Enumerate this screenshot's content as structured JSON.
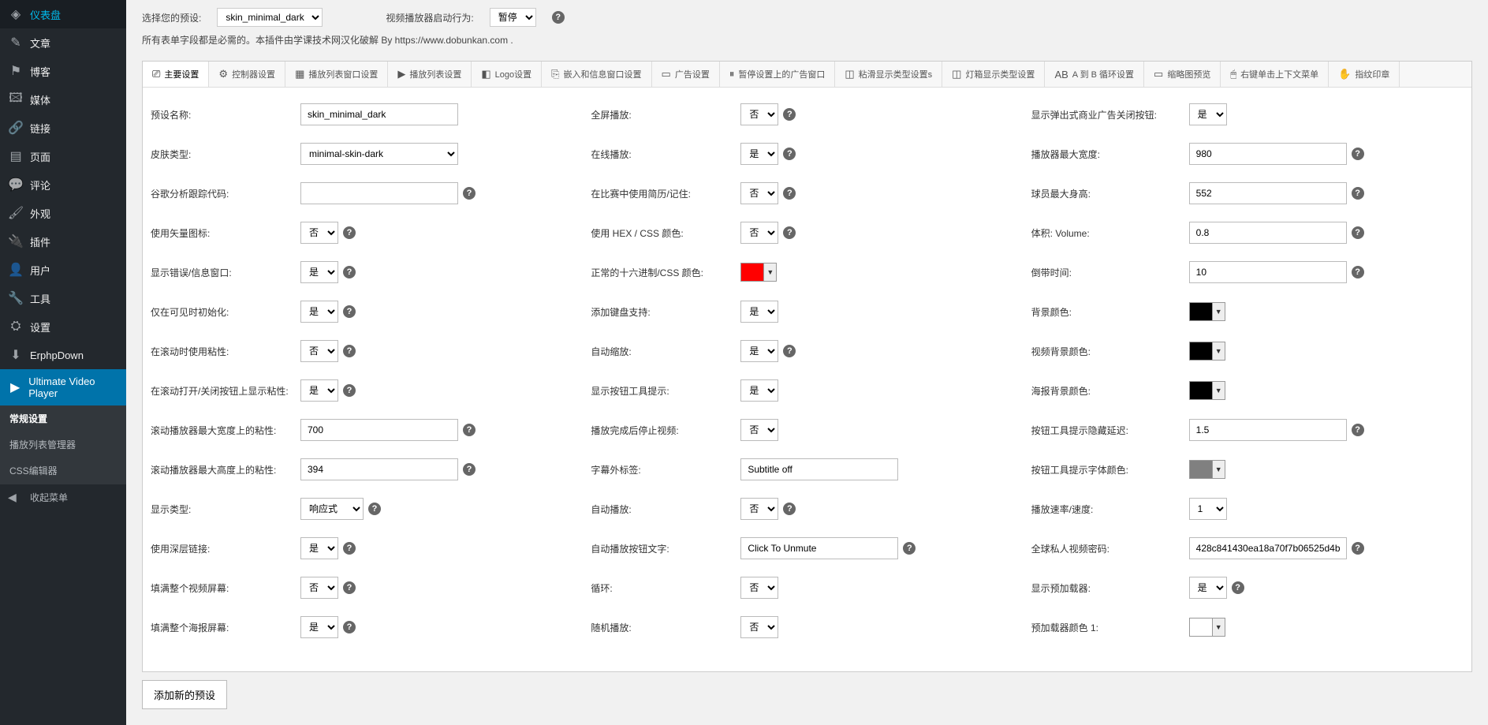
{
  "sidebar": {
    "items": [
      {
        "icon": "◈",
        "label": "仪表盘"
      },
      {
        "icon": "✎",
        "label": "文章"
      },
      {
        "icon": "⚑",
        "label": "博客"
      },
      {
        "icon": "🖾",
        "label": "媒体"
      },
      {
        "icon": "🔗",
        "label": "链接"
      },
      {
        "icon": "▤",
        "label": "页面"
      },
      {
        "icon": "💬",
        "label": "评论"
      },
      {
        "icon": "🖌",
        "label": "外观"
      },
      {
        "icon": "🔌",
        "label": "插件"
      },
      {
        "icon": "👤",
        "label": "用户"
      },
      {
        "icon": "🔧",
        "label": "工具"
      },
      {
        "icon": "⛭",
        "label": "设置"
      },
      {
        "icon": "⬇",
        "label": "ErphpDown"
      },
      {
        "icon": "▶",
        "label": "Ultimate Video Player",
        "active": true
      }
    ],
    "sub": [
      "常规设置",
      "播放列表管理器",
      "CSS编辑器"
    ],
    "sub_current": "常规设置",
    "collapse": "收起菜单"
  },
  "top": {
    "preset_label": "选择您的预设:",
    "preset_value": "skin_minimal_dark",
    "startup_label": "视频播放器启动行为:",
    "startup_value": "暂停"
  },
  "note": "所有表单字段都是必需的。本插件由学课技术网汉化破解 By https://www.dobunkan.com .",
  "tabs": [
    {
      "icon": "⎚",
      "label": "主要设置",
      "active": true
    },
    {
      "icon": "⚙",
      "label": "控制器设置"
    },
    {
      "icon": "▦",
      "label": "播放列表窗口设置"
    },
    {
      "icon": "▶",
      "label": "播放列表设置"
    },
    {
      "icon": "◧",
      "label": "Logo设置"
    },
    {
      "icon": "⎘",
      "label": "嵌入和信息窗口设置"
    },
    {
      "icon": "▭",
      "label": "广告设置"
    },
    {
      "icon": "⏸",
      "label": "暂停设置上的广告窗口"
    },
    {
      "icon": "◫",
      "label": "粘滑显示类型设置s"
    },
    {
      "icon": "◫",
      "label": "灯箱显示类型设置"
    },
    {
      "icon": "AB",
      "label": "A 到 B 循环设置"
    },
    {
      "icon": "▭",
      "label": "缩略图预览"
    },
    {
      "icon": "🖱",
      "label": "右键单击上下文菜单"
    },
    {
      "icon": "✋",
      "label": "指纹印章"
    }
  ],
  "f": {
    "c1": [
      {
        "label": "预设名称:",
        "type": "text",
        "value": "skin_minimal_dark",
        "help": 0
      },
      {
        "label": "皮肤类型:",
        "type": "select_med",
        "value": "minimal-skin-dark",
        "help": 0
      },
      {
        "label": "谷歌分析跟踪代码:",
        "type": "text",
        "value": "",
        "help": 1
      },
      {
        "label": "使用矢量图标:",
        "type": "select_small",
        "value": "否",
        "help": 1
      },
      {
        "label": "显示错误/信息窗口:",
        "type": "select_small",
        "value": "是",
        "help": 1
      },
      {
        "label": "仅在可见时初始化:",
        "type": "select_small",
        "value": "是",
        "help": 1
      },
      {
        "label": "在滚动时使用粘性:",
        "type": "select_small",
        "value": "否",
        "help": 1
      },
      {
        "label": "在滚动打开/关闭按钮上显示粘性:",
        "type": "select_small",
        "value": "是",
        "help": 1
      },
      {
        "label": "滚动播放器最大宽度上的粘性:",
        "type": "text",
        "value": "700",
        "help": 1
      },
      {
        "label": "滚动播放器最大高度上的粘性:",
        "type": "text",
        "value": "394",
        "help": 1
      },
      {
        "label": "显示类型:",
        "type": "select_med_v",
        "value": "响应式",
        "help": 1
      },
      {
        "label": "使用深层链接:",
        "type": "select_small",
        "value": "是",
        "help": 1
      },
      {
        "label": "填满整个视频屏幕:",
        "type": "select_small",
        "value": "否",
        "help": 1
      },
      {
        "label": "填满整个海报屏幕:",
        "type": "select_small",
        "value": "是",
        "help": 1
      }
    ],
    "c2": [
      {
        "label": "全屏播放:",
        "type": "select_small",
        "value": "否",
        "help": 1
      },
      {
        "label": "在线播放:",
        "type": "select_small",
        "value": "是",
        "help": 1
      },
      {
        "label": "在比赛中使用简历/记住:",
        "type": "select_small",
        "value": "否",
        "help": 1
      },
      {
        "label": "使用 HEX / CSS 颜色:",
        "type": "select_small",
        "value": "否",
        "help": 1
      },
      {
        "label": "正常的十六进制/CSS 颜色:",
        "type": "color",
        "value": "#FF0000",
        "help": 0
      },
      {
        "label": "添加键盘支持:",
        "type": "select_small",
        "value": "是",
        "help": 0
      },
      {
        "label": "自动缩放:",
        "type": "select_small",
        "value": "是",
        "help": 1
      },
      {
        "label": "显示按钮工具提示:",
        "type": "select_small",
        "value": "是",
        "help": 0
      },
      {
        "label": "播放完成后停止视频:",
        "type": "select_small",
        "value": "否",
        "help": 0
      },
      {
        "label": "字幕外标签:",
        "type": "text",
        "value": "Subtitle off",
        "help": 0
      },
      {
        "label": "自动播放:",
        "type": "select_small",
        "value": "否",
        "help": 1
      },
      {
        "label": "自动播放按钮文字:",
        "type": "text",
        "value": "Click To Unmute",
        "help": 1
      },
      {
        "label": "循环:",
        "type": "select_small",
        "value": "否",
        "help": 0
      },
      {
        "label": "随机播放:",
        "type": "select_small",
        "value": "否",
        "help": 0
      }
    ],
    "c3": [
      {
        "label": "显示弹出式商业广告关闭按钮:",
        "type": "select_small",
        "value": "是",
        "help": 0
      },
      {
        "label": "播放器最大宽度:",
        "type": "text",
        "value": "980",
        "help": 1
      },
      {
        "label": "球员最大身高:",
        "type": "text",
        "value": "552",
        "help": 1
      },
      {
        "label": "体积: Volume:",
        "type": "text",
        "value": "0.8",
        "help": 1
      },
      {
        "label": "倒带时间:",
        "type": "text",
        "value": "10",
        "help": 1
      },
      {
        "label": "背景颜色:",
        "type": "color",
        "value": "#000000",
        "help": 0
      },
      {
        "label": "视频背景颜色:",
        "type": "color",
        "value": "#000000",
        "help": 0
      },
      {
        "label": "海报背景颜色:",
        "type": "color",
        "value": "#000000",
        "help": 0
      },
      {
        "label": "按钮工具提示隐藏延迟:",
        "type": "text",
        "value": "1.5",
        "help": 1
      },
      {
        "label": "按钮工具提示字体颜色:",
        "type": "color",
        "value": "#808080",
        "help": 0
      },
      {
        "label": "播放速率/速度:",
        "type": "select_small",
        "value": "1",
        "help": 0
      },
      {
        "label": "全球私人视频密码:",
        "type": "text",
        "value": "428c841430ea18a70f7b06525d4b",
        "help": 1
      },
      {
        "label": "显示预加载器:",
        "type": "select_small",
        "value": "是",
        "help": 1
      },
      {
        "label": "预加载器颜色 1:",
        "type": "color",
        "value": "#FFFFFF",
        "help": 0
      }
    ]
  },
  "add_button": "添加新的预设"
}
